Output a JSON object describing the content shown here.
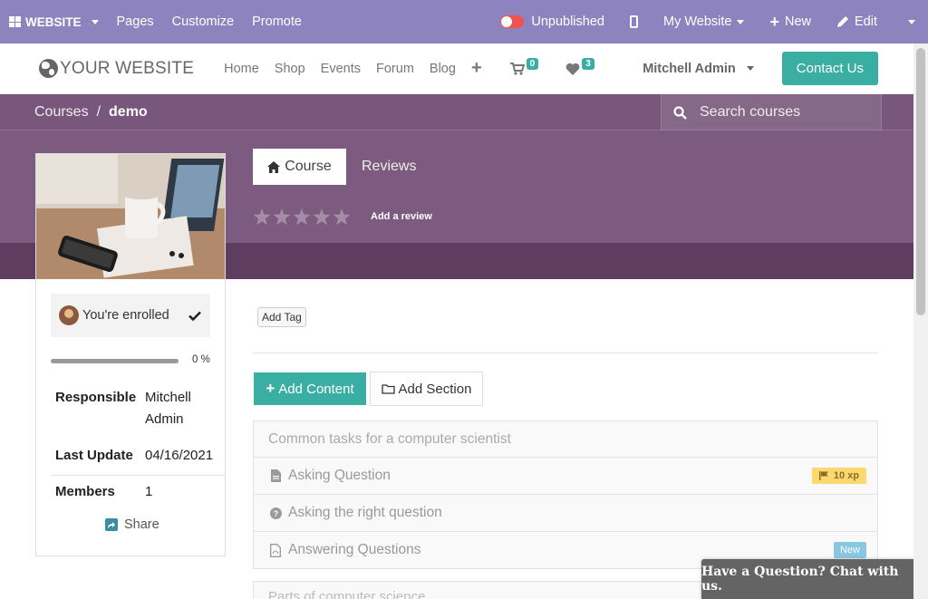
{
  "adminbar": {
    "brand_label": "WEBSITE",
    "menu": [
      "Pages",
      "Customize",
      "Promote"
    ],
    "publish_status": "Unpublished",
    "website_selector": "My Website",
    "new_label": "New",
    "edit_label": "Edit"
  },
  "sitenav": {
    "logo_text": "YOUR WEBSITE",
    "links": [
      "Home",
      "Shop",
      "Events",
      "Forum",
      "Blog"
    ],
    "cart_count": "0",
    "wishlist_count": "3",
    "user_name": "Mitchell Admin",
    "contact_label": "Contact Us"
  },
  "header": {
    "breadcrumb_parent": "Courses",
    "breadcrumb_separator": "/",
    "breadcrumb_current": "demo",
    "search_placeholder": "Search courses",
    "course_title": "demo",
    "rating_stars": 0,
    "add_review_label": "Add a review",
    "tabs": [
      "Course",
      "Reviews"
    ]
  },
  "sidebar": {
    "enrolled_label": "You're enrolled",
    "progress_percent": 0,
    "progress_label": "0 %",
    "responsible_key": "Responsible",
    "responsible_value": "Mitchell Admin",
    "last_update_key": "Last Update",
    "last_update_value": "04/16/2021",
    "members_key": "Members",
    "members_value": "1",
    "share_label": "Share"
  },
  "content": {
    "add_tag_label": "Add Tag",
    "add_content_label": "Add Content",
    "add_section_label": "Add Section",
    "section_title": "Common tasks for a computer scientist",
    "items": [
      {
        "title": "Asking Question",
        "icon": "document-icon",
        "badge": "10 xp"
      },
      {
        "title": "Asking the right question",
        "icon": "question-circle-icon"
      },
      {
        "title": "Answering Questions",
        "icon": "pdf-icon",
        "badge": "New"
      }
    ],
    "next_section_title": "Parts of computer science"
  },
  "chat": {
    "label": "Have a Question? Chat with us."
  },
  "colors": {
    "admin_bar": "#8d84bf",
    "header_purple": "#7d5a80",
    "accent_teal": "#3aaea2",
    "unpublished_red": "#ef5350"
  }
}
